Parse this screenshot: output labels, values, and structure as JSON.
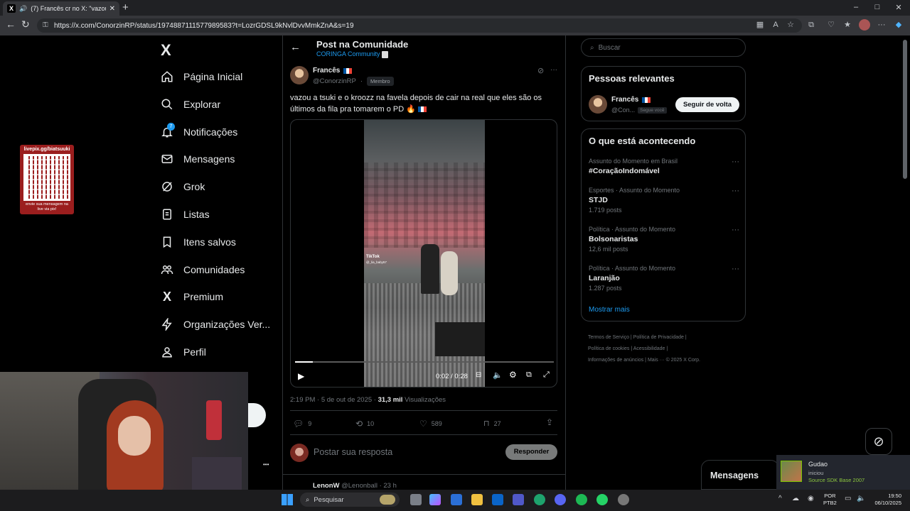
{
  "browser": {
    "tab_title": "(7) Francês cr no X: \"vazou a",
    "new_tab": "+",
    "url": "https://x.com/ConorzinRP/status/1974887111577989583?t=LozrGDSL9kNvlDvvMmkZnA&s=19",
    "window_controls": [
      "–",
      "□",
      "✕"
    ]
  },
  "nav": {
    "logo": "X",
    "items": [
      {
        "label": "Página Inicial",
        "icon": "home-icon"
      },
      {
        "label": "Explorar",
        "icon": "search-icon"
      },
      {
        "label": "Notificações",
        "icon": "bell-icon",
        "badge": "7"
      },
      {
        "label": "Mensagens",
        "icon": "mail-icon"
      },
      {
        "label": "Grok",
        "icon": "grok-icon"
      },
      {
        "label": "Listas",
        "icon": "list-icon"
      },
      {
        "label": "Itens salvos",
        "icon": "bookmark-icon"
      },
      {
        "label": "Comunidades",
        "icon": "communities-icon"
      },
      {
        "label": "Premium",
        "icon": "x-premium-icon"
      },
      {
        "label": "Organizações Ver...",
        "icon": "lightning-icon"
      },
      {
        "label": "Perfil",
        "icon": "person-icon"
      }
    ],
    "more_dots": "•••"
  },
  "overlay": {
    "qr_header": "livepix.gg/biatsuuki",
    "qr_footer": "envie sua mensagem na live via pix!"
  },
  "post": {
    "header_title": "Post na Comunidade",
    "community": "CORINGA Community",
    "author_name": "Francês",
    "author_handle": "@ConorzinRP",
    "member_badge": "Membro",
    "text": "vazou a tsuki e o kroozz na favela depois de cair na real que eles são os últimos da fila pra tomarem o PD 🔥",
    "video_time": "0:02 / 0:28",
    "tiktok_label": "TikTok",
    "tiktok_handle": "@_lia_baby57",
    "timestamp": "2:19 PM · 5 de out de 2025 · ",
    "views_count": "31,3 mil",
    "views_label": "Visualizações",
    "replies": "9",
    "reposts": "10",
    "likes": "589",
    "bookmarks": "27",
    "reply_placeholder": "Postar sua resposta",
    "reply_button": "Responder",
    "next_author": "LenonW",
    "next_handle": "@Lenonball · 23 h"
  },
  "sidebar": {
    "search_placeholder": "Buscar",
    "relevant_title": "Pessoas relevantes",
    "person_name": "Francês",
    "person_handle": "@Con...",
    "follows_you": "Segue você",
    "follow_back": "Seguir de volta",
    "trending_title": "O que está acontecendo",
    "trends": [
      {
        "category": "Assunto do Momento em Brasil",
        "name": "#CoraçãoIndomável",
        "count": ""
      },
      {
        "category": "Esportes · Assunto do Momento",
        "name": "STJD",
        "count": "1.719 posts"
      },
      {
        "category": "Política · Assunto do Momento",
        "name": "Bolsonaristas",
        "count": "12,6 mil posts"
      },
      {
        "category": "Política · Assunto do Momento",
        "name": "Laranjão",
        "count": "1.287 posts"
      }
    ],
    "show_more": "Mostrar mais",
    "footer_links": [
      "Termos de Serviço",
      "Política de Privacidade",
      "Política de cookies",
      "Acessibilidade",
      "Informações de anúncios",
      "Mais ···",
      "© 2025 X Corp."
    ]
  },
  "messages_drawer": "Mensagens",
  "toast": {
    "name": "Gudao",
    "action": "iniciou",
    "app": "Source SDK Base 2007"
  },
  "taskbar": {
    "search": "Pesquisar",
    "lang_top": "POR",
    "lang_bottom": "PTB2",
    "time": "19:50",
    "date": "06/10/2025"
  },
  "colors": {
    "accent": "#1d9bf0",
    "background": "#000000",
    "border": "#2f3336",
    "muted": "#71767b"
  }
}
